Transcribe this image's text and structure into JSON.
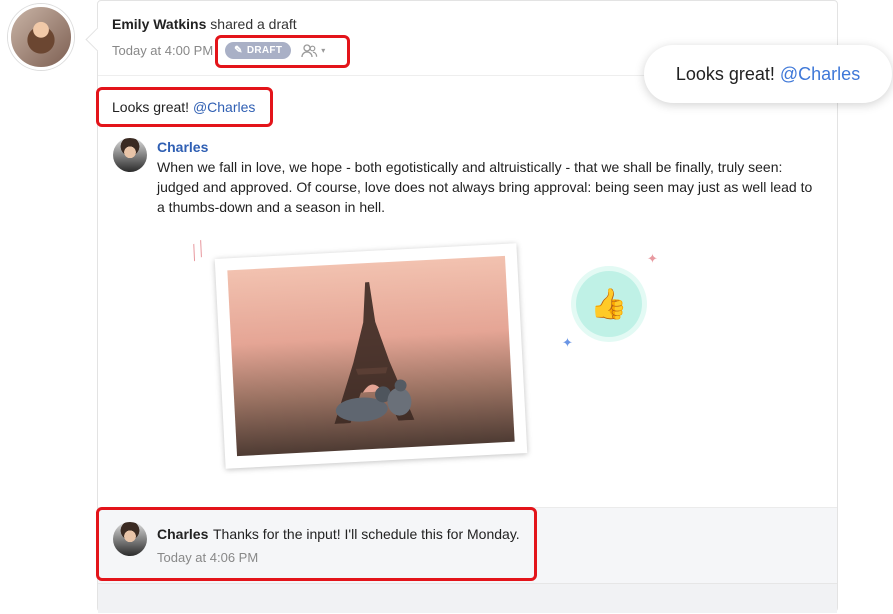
{
  "post": {
    "author": "Emily Watkins",
    "action": "shared a draft",
    "time": "Today at 4:00 PM",
    "badge": "DRAFT"
  },
  "comment": {
    "text": "Looks great!",
    "mention": "@Charles"
  },
  "reply": {
    "author": "Charles",
    "text": "When we fall in love, we hope - both egotistically and altruistically - that we shall be finally, truly seen: judged and approved. Of course, love does not always bring approval: being seen may just as well lead to a thumbs-down and a season in hell."
  },
  "footer_reply": {
    "author": "Charles",
    "text": "Thanks for the input! I'll schedule this for Monday.",
    "time": "Today at 4:06 PM"
  },
  "bubble": {
    "text": "Looks great!",
    "mention": "@Charles"
  },
  "icons": {
    "draft_badge_icon": "pencil-icon",
    "visibility_icon": "people-icon",
    "reaction": "thumbs-up-icon"
  },
  "colors": {
    "mention": "#2f5fb3",
    "highlight": "#e3141a",
    "badge_bg": "#a9b0c6",
    "reaction_bg": "#bff1e6"
  }
}
